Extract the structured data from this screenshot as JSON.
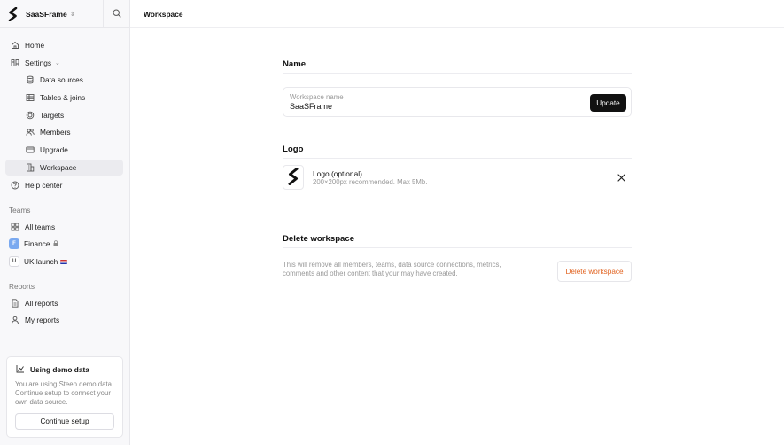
{
  "sidebar": {
    "workspace_name": "SaaSFrame",
    "nav": {
      "home": "Home",
      "settings": "Settings",
      "data_sources": "Data sources",
      "tables_joins": "Tables & joins",
      "targets": "Targets",
      "members": "Members",
      "upgrade": "Upgrade",
      "workspace": "Workspace",
      "help_center": "Help center"
    },
    "teams": {
      "section_label": "Teams",
      "all_teams": "All teams",
      "finance": {
        "label": "Finance",
        "badge": "F"
      },
      "uk_launch": {
        "label": "UK launch",
        "badge": "U"
      }
    },
    "reports": {
      "section_label": "Reports",
      "all_reports": "All reports",
      "my_reports": "My reports"
    },
    "demo_card": {
      "title": "Using demo data",
      "text": "You are using Steep demo data. Continue setup to connect your own data source.",
      "button": "Continue setup"
    }
  },
  "header": {
    "title": "Workspace"
  },
  "name_section": {
    "title": "Name",
    "field_placeholder": "Workspace name",
    "field_value": "SaaSFrame",
    "update_button": "Update"
  },
  "logo_section": {
    "title": "Logo",
    "label": "Logo (optional)",
    "hint": "200×200px recommended. Max 5Mb."
  },
  "delete_section": {
    "title": "Delete workspace",
    "description": "This will remove all members, teams, data source connections, metrics, comments and other content that your may have created.",
    "button": "Delete workspace"
  },
  "colors": {
    "accent_danger": "#e1621f",
    "primary_button": "#111111",
    "sidebar_bg": "#f8f8fa",
    "team_finance": "#7aa9f0"
  }
}
